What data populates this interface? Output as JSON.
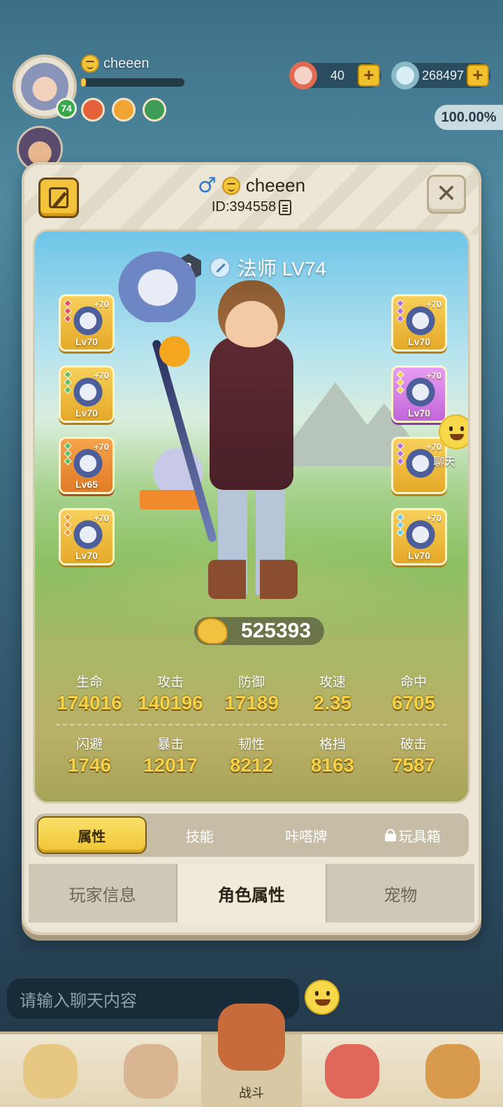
{
  "hud": {
    "player_name": "cheeen",
    "level": "74",
    "currency_1": "40",
    "currency_2": "268497",
    "percent": "100.00%",
    "xp_fraction": 0.05
  },
  "modal": {
    "name": "cheeen",
    "id_text": "ID:394558",
    "class_text": "法师 LV74",
    "rank": "3",
    "power": "525393",
    "equip_left": [
      {
        "plus": "+70",
        "level": "Lv70",
        "style": "gold"
      },
      {
        "plus": "+70",
        "level": "Lv70",
        "style": "gold"
      },
      {
        "plus": "+70",
        "level": "Lv65",
        "style": "orange"
      },
      {
        "plus": "+70",
        "level": "Lv70",
        "style": "gold"
      }
    ],
    "equip_right": [
      {
        "plus": "+70",
        "level": "Lv70",
        "style": "gold"
      },
      {
        "plus": "+70",
        "level": "Lv70",
        "style": "purple"
      },
      {
        "plus": "+70",
        "level": "",
        "style": "gold"
      },
      {
        "plus": "+70",
        "level": "Lv70",
        "style": "gold"
      }
    ],
    "chat_label": "聊天",
    "stats_row1": [
      {
        "label": "生命",
        "value": "174016"
      },
      {
        "label": "攻击",
        "value": "140196"
      },
      {
        "label": "防御",
        "value": "17189"
      },
      {
        "label": "攻速",
        "value": "2.35"
      },
      {
        "label": "命中",
        "value": "6705"
      }
    ],
    "stats_row2": [
      {
        "label": "闪避",
        "value": "1746"
      },
      {
        "label": "暴击",
        "value": "12017"
      },
      {
        "label": "韧性",
        "value": "8212"
      },
      {
        "label": "格挡",
        "value": "8163"
      },
      {
        "label": "破击",
        "value": "7587"
      }
    ],
    "subtabs": [
      "属性",
      "技能",
      "咔嗒牌",
      "玩具箱"
    ],
    "bottom_tabs": [
      "玩家信息",
      "角色属性",
      "宠物"
    ]
  },
  "chat": {
    "placeholder": "请输入聊天内容"
  },
  "nav": {
    "battle_label": "战斗"
  },
  "colors": {
    "accent": "#f0c534",
    "stat_value": "#f5d24a",
    "modal_bg": "#ece6d6"
  }
}
